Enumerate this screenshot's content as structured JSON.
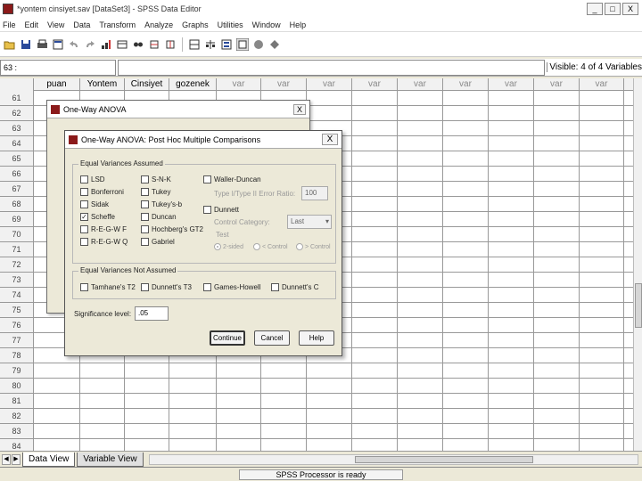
{
  "window": {
    "title": "*yontem cinsiyet.sav [DataSet3] - SPSS Data Editor",
    "minimize": "_",
    "maximize": "□",
    "close": "X"
  },
  "menu": [
    "File",
    "Edit",
    "View",
    "Data",
    "Transform",
    "Analyze",
    "Graphs",
    "Utilities",
    "Window",
    "Help"
  ],
  "cell_editor": {
    "cell_ref": "63 :",
    "value": "",
    "visible": "Visible: 4 of 4 Variables"
  },
  "grid": {
    "columns": [
      "puan",
      "Yontem",
      "Cinsiyet",
      "gozenek",
      "var",
      "var",
      "var",
      "var",
      "var",
      "var",
      "var",
      "var",
      "var"
    ],
    "rows": [
      "61",
      "62",
      "63",
      "64",
      "65",
      "66",
      "67",
      "68",
      "69",
      "70",
      "71",
      "72",
      "73",
      "74",
      "75",
      "76",
      "77",
      "78",
      "79",
      "80",
      "81",
      "82",
      "83",
      "84"
    ]
  },
  "tabs": {
    "data_view": "Data View",
    "variable_view": "Variable View"
  },
  "status": "SPSS Processor is ready",
  "anova_dialog": {
    "title": "One-Way ANOVA"
  },
  "posthoc_dialog": {
    "title": "One-Way ANOVA: Post Hoc Multiple Comparisons",
    "close": "X",
    "equal_assumed": {
      "legend": "Equal Variances Assumed",
      "lsd": "LSD",
      "bonferroni": "Bonferroni",
      "sidak": "Sidak",
      "scheffe": "Scheffe",
      "regwf": "R-E-G-W F",
      "regwq": "R-E-G-W Q",
      "snk": "S-N-K",
      "tukey": "Tukey",
      "tukeysb": "Tukey's-b",
      "duncan": "Duncan",
      "hochberg": "Hochberg's GT2",
      "gabriel": "Gabriel",
      "waller": "Waller-Duncan",
      "type_error_ratio": "Type I/Type II Error Ratio:",
      "error_ratio_value": "100",
      "dunnett": "Dunnett",
      "control_category": "Control Category:",
      "control_value": "Last",
      "test": "Test",
      "two_sided": "2-sided",
      "lt_control": "< Control",
      "gt_control": "> Control"
    },
    "not_assumed": {
      "legend": "Equal Variances Not Assumed",
      "tamhane": "Tamhane's T2",
      "dunnett_t3": "Dunnett's T3",
      "games_howell": "Games-Howell",
      "dunnett_c": "Dunnett's C"
    },
    "significance_label": "Significance level:",
    "significance_value": ".05",
    "continue": "Continue",
    "cancel": "Cancel",
    "help": "Help",
    "checked_mark": "✓"
  }
}
